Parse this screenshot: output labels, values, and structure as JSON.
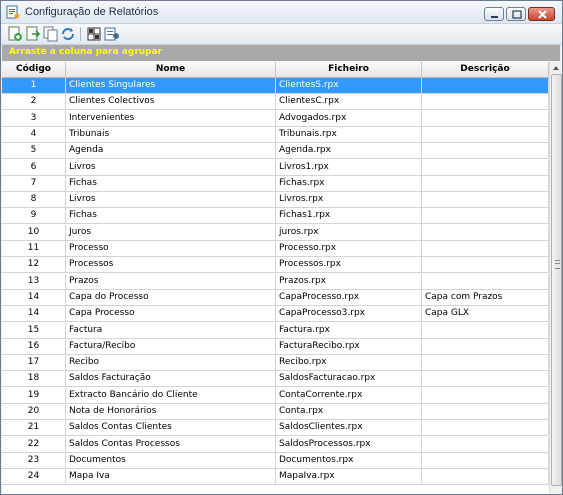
{
  "window": {
    "title": "Configuração de Relatórios"
  },
  "toolbar": {
    "buttons": [
      "new-report-icon",
      "export-icon",
      "copy-icon",
      "refresh-icon",
      "grid-icon",
      "properties-icon"
    ]
  },
  "grid": {
    "group_hint": "Arraste a coluna para agrupar",
    "columns": [
      "Código",
      "Nome",
      "Ficheiro",
      "Descrição"
    ],
    "selected_index": 0,
    "rows": [
      {
        "codigo": "1",
        "nome": "Clientes Singulares",
        "ficheiro": "ClientesS.rpx",
        "descricao": ""
      },
      {
        "codigo": "2",
        "nome": "Clientes Colectivos",
        "ficheiro": "ClientesC.rpx",
        "descricao": ""
      },
      {
        "codigo": "3",
        "nome": "Intervenientes",
        "ficheiro": "Advogados.rpx",
        "descricao": ""
      },
      {
        "codigo": "4",
        "nome": "Tribunais",
        "ficheiro": "Tribunais.rpx",
        "descricao": ""
      },
      {
        "codigo": "5",
        "nome": "Agenda",
        "ficheiro": "Agenda.rpx",
        "descricao": ""
      },
      {
        "codigo": "6",
        "nome": "Livros",
        "ficheiro": "Livros1.rpx",
        "descricao": ""
      },
      {
        "codigo": "7",
        "nome": "Fichas",
        "ficheiro": "Fichas.rpx",
        "descricao": ""
      },
      {
        "codigo": "8",
        "nome": "Livros",
        "ficheiro": "Livros.rpx",
        "descricao": ""
      },
      {
        "codigo": "9",
        "nome": "Fichas",
        "ficheiro": "Fichas1.rpx",
        "descricao": ""
      },
      {
        "codigo": "10",
        "nome": "Juros",
        "ficheiro": "juros.rpx",
        "descricao": ""
      },
      {
        "codigo": "11",
        "nome": "Processo",
        "ficheiro": "Processo.rpx",
        "descricao": ""
      },
      {
        "codigo": "12",
        "nome": "Processos",
        "ficheiro": "Processos.rpx",
        "descricao": ""
      },
      {
        "codigo": "13",
        "nome": "Prazos",
        "ficheiro": "Prazos.rpx",
        "descricao": ""
      },
      {
        "codigo": "14",
        "nome": "Capa do Processo",
        "ficheiro": "CapaProcesso.rpx",
        "descricao": "Capa com Prazos"
      },
      {
        "codigo": "14",
        "nome": "Capa Processo",
        "ficheiro": "CapaProcesso3.rpx",
        "descricao": "Capa GLX"
      },
      {
        "codigo": "15",
        "nome": "Factura",
        "ficheiro": "Factura.rpx",
        "descricao": ""
      },
      {
        "codigo": "16",
        "nome": "Factura/Recibo",
        "ficheiro": "FacturaRecibo.rpx",
        "descricao": ""
      },
      {
        "codigo": "17",
        "nome": "Recibo",
        "ficheiro": "Recibo.rpx",
        "descricao": ""
      },
      {
        "codigo": "18",
        "nome": "Saldos Facturação",
        "ficheiro": "SaldosFacturacao.rpx",
        "descricao": ""
      },
      {
        "codigo": "19",
        "nome": "Extracto Bancário do Cliente",
        "ficheiro": "ContaCorrente.rpx",
        "descricao": ""
      },
      {
        "codigo": "20",
        "nome": "Nota de Honorários",
        "ficheiro": "Conta.rpx",
        "descricao": ""
      },
      {
        "codigo": "21",
        "nome": "Saldos Contas Clientes",
        "ficheiro": "SaldosClientes.rpx",
        "descricao": ""
      },
      {
        "codigo": "22",
        "nome": "Saldos Contas Processos",
        "ficheiro": "SaldosProcessos.rpx",
        "descricao": ""
      },
      {
        "codigo": "23",
        "nome": "Documentos",
        "ficheiro": "Documentos.rpx",
        "descricao": ""
      },
      {
        "codigo": "24",
        "nome": "Mapa Iva",
        "ficheiro": "MapaIva.rpx",
        "descricao": ""
      }
    ]
  },
  "colors": {
    "selection": "#3399ff",
    "group_text": "#ffff00",
    "group_bar": "#a9a9a9"
  }
}
